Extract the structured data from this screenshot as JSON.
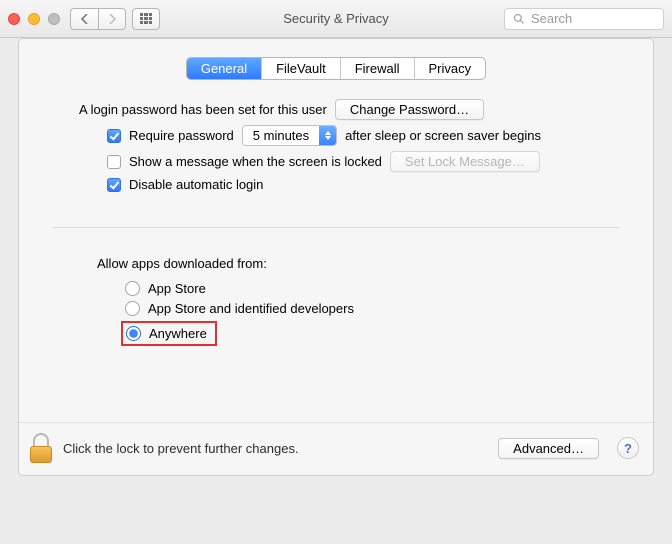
{
  "window": {
    "title": "Security & Privacy",
    "search_placeholder": "Search"
  },
  "tabs": {
    "general": "General",
    "filevault": "FileVault",
    "firewall": "Firewall",
    "privacy": "Privacy"
  },
  "login": {
    "password_set_text": "A login password has been set for this user",
    "change_password_btn": "Change Password…",
    "require_password_label": "Require password",
    "require_password_checked": true,
    "delay_selected": "5 minutes",
    "after_sleep_text": "after sleep or screen saver begins",
    "show_message_label": "Show a message when the screen is locked",
    "show_message_checked": false,
    "set_lock_message_btn": "Set Lock Message…",
    "disable_auto_login_label": "Disable automatic login",
    "disable_auto_login_checked": true
  },
  "gatekeeper": {
    "heading": "Allow apps downloaded from:",
    "options": {
      "app_store": "App Store",
      "identified": "App Store and identified developers",
      "anywhere": "Anywhere"
    },
    "selected": "anywhere"
  },
  "footer": {
    "lock_text": "Click the lock to prevent further changes.",
    "advanced_btn": "Advanced…",
    "help": "?"
  }
}
